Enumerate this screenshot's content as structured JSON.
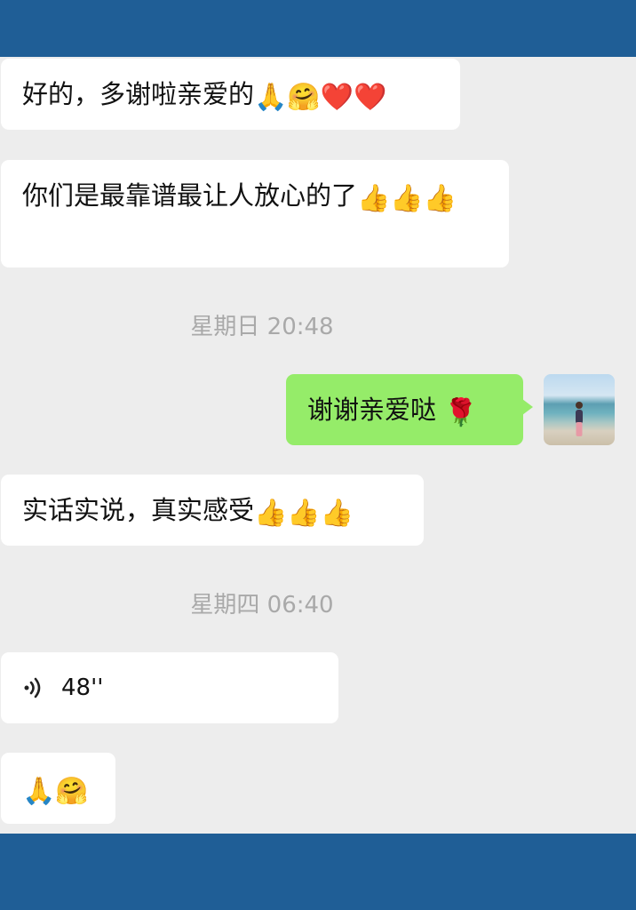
{
  "colors": {
    "header_band": "#1f5e96",
    "chat_background": "#ededed",
    "incoming_bubble": "#ffffff",
    "outgoing_bubble": "#95ec69",
    "timestamp_text": "#a9a9a9"
  },
  "messages": [
    {
      "type": "text",
      "direction": "incoming",
      "text": "好的，多谢啦亲爱的",
      "emojis": "🙏🤗❤️❤️"
    },
    {
      "type": "text",
      "direction": "incoming",
      "text": "你们是最靠谱最让人放心的了",
      "emojis": "👍👍👍"
    },
    {
      "type": "timestamp",
      "text": "星期日 20:48"
    },
    {
      "type": "text",
      "direction": "outgoing",
      "text": "谢谢亲爱哒",
      "emojis": "🌹"
    },
    {
      "type": "text",
      "direction": "incoming",
      "text": "实话实说，真实感受",
      "emojis": "👍👍👍"
    },
    {
      "type": "timestamp",
      "text": "星期四 06:40"
    },
    {
      "type": "voice",
      "direction": "incoming",
      "duration": "48''",
      "icon": "voice-wave-icon"
    },
    {
      "type": "text",
      "direction": "incoming",
      "text": "",
      "emojis": "🙏🤗"
    }
  ],
  "avatar": {
    "description_icon": "beach-photo-avatar"
  }
}
